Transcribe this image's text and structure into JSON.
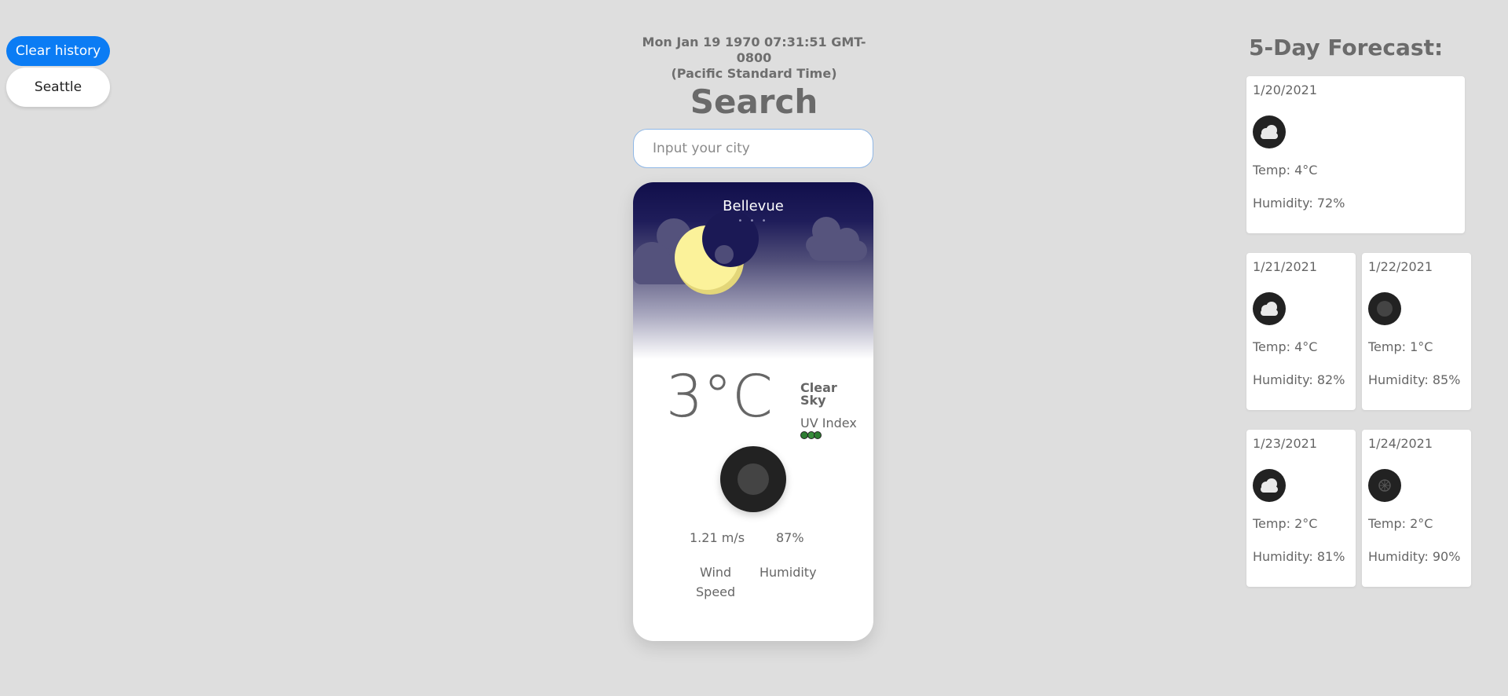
{
  "history": {
    "clear_label": "Clear history",
    "cities": [
      "Seattle"
    ]
  },
  "header": {
    "datetime_line1": "Mon Jan 19 1970 07:31:51 GMT-0800",
    "datetime_line2": "(Pacific Standard Time)",
    "title": "Search"
  },
  "search": {
    "placeholder": "Input your city",
    "value": ""
  },
  "current": {
    "city": "Bellevue",
    "dots": "• • •",
    "temperature": "3°C",
    "description_line1": "Clear",
    "description_line2": "Sky",
    "uv_label": "UV Index",
    "wind_value": "1.21 m/s",
    "wind_label_line1": "Wind",
    "wind_label_line2": "Speed",
    "humidity_value": "87%",
    "humidity_label": "Humidity",
    "icon": "night-clear-icon"
  },
  "forecast": {
    "title": "5-Day Forecast:",
    "days": [
      {
        "date": "1/20/2021",
        "icon": "cloud-icon",
        "temp": "Temp: 4°C",
        "humidity": "Humidity: 72%"
      },
      {
        "date": "1/21/2021",
        "icon": "cloud-icon",
        "temp": "Temp: 4°C",
        "humidity": "Humidity: 82%"
      },
      {
        "date": "1/22/2021",
        "icon": "clear-icon",
        "temp": "Temp: 1°C",
        "humidity": "Humidity: 85%"
      },
      {
        "date": "1/23/2021",
        "icon": "cloud-icon",
        "temp": "Temp: 2°C",
        "humidity": "Humidity: 81%"
      },
      {
        "date": "1/24/2021",
        "icon": "snow-icon",
        "temp": "Temp: 2°C",
        "humidity": "Humidity: 90%"
      }
    ]
  },
  "colors": {
    "accent": "#0b7cf4",
    "background": "#dedede",
    "sky_top": "#110f4b",
    "moon": "#fbf29a"
  }
}
